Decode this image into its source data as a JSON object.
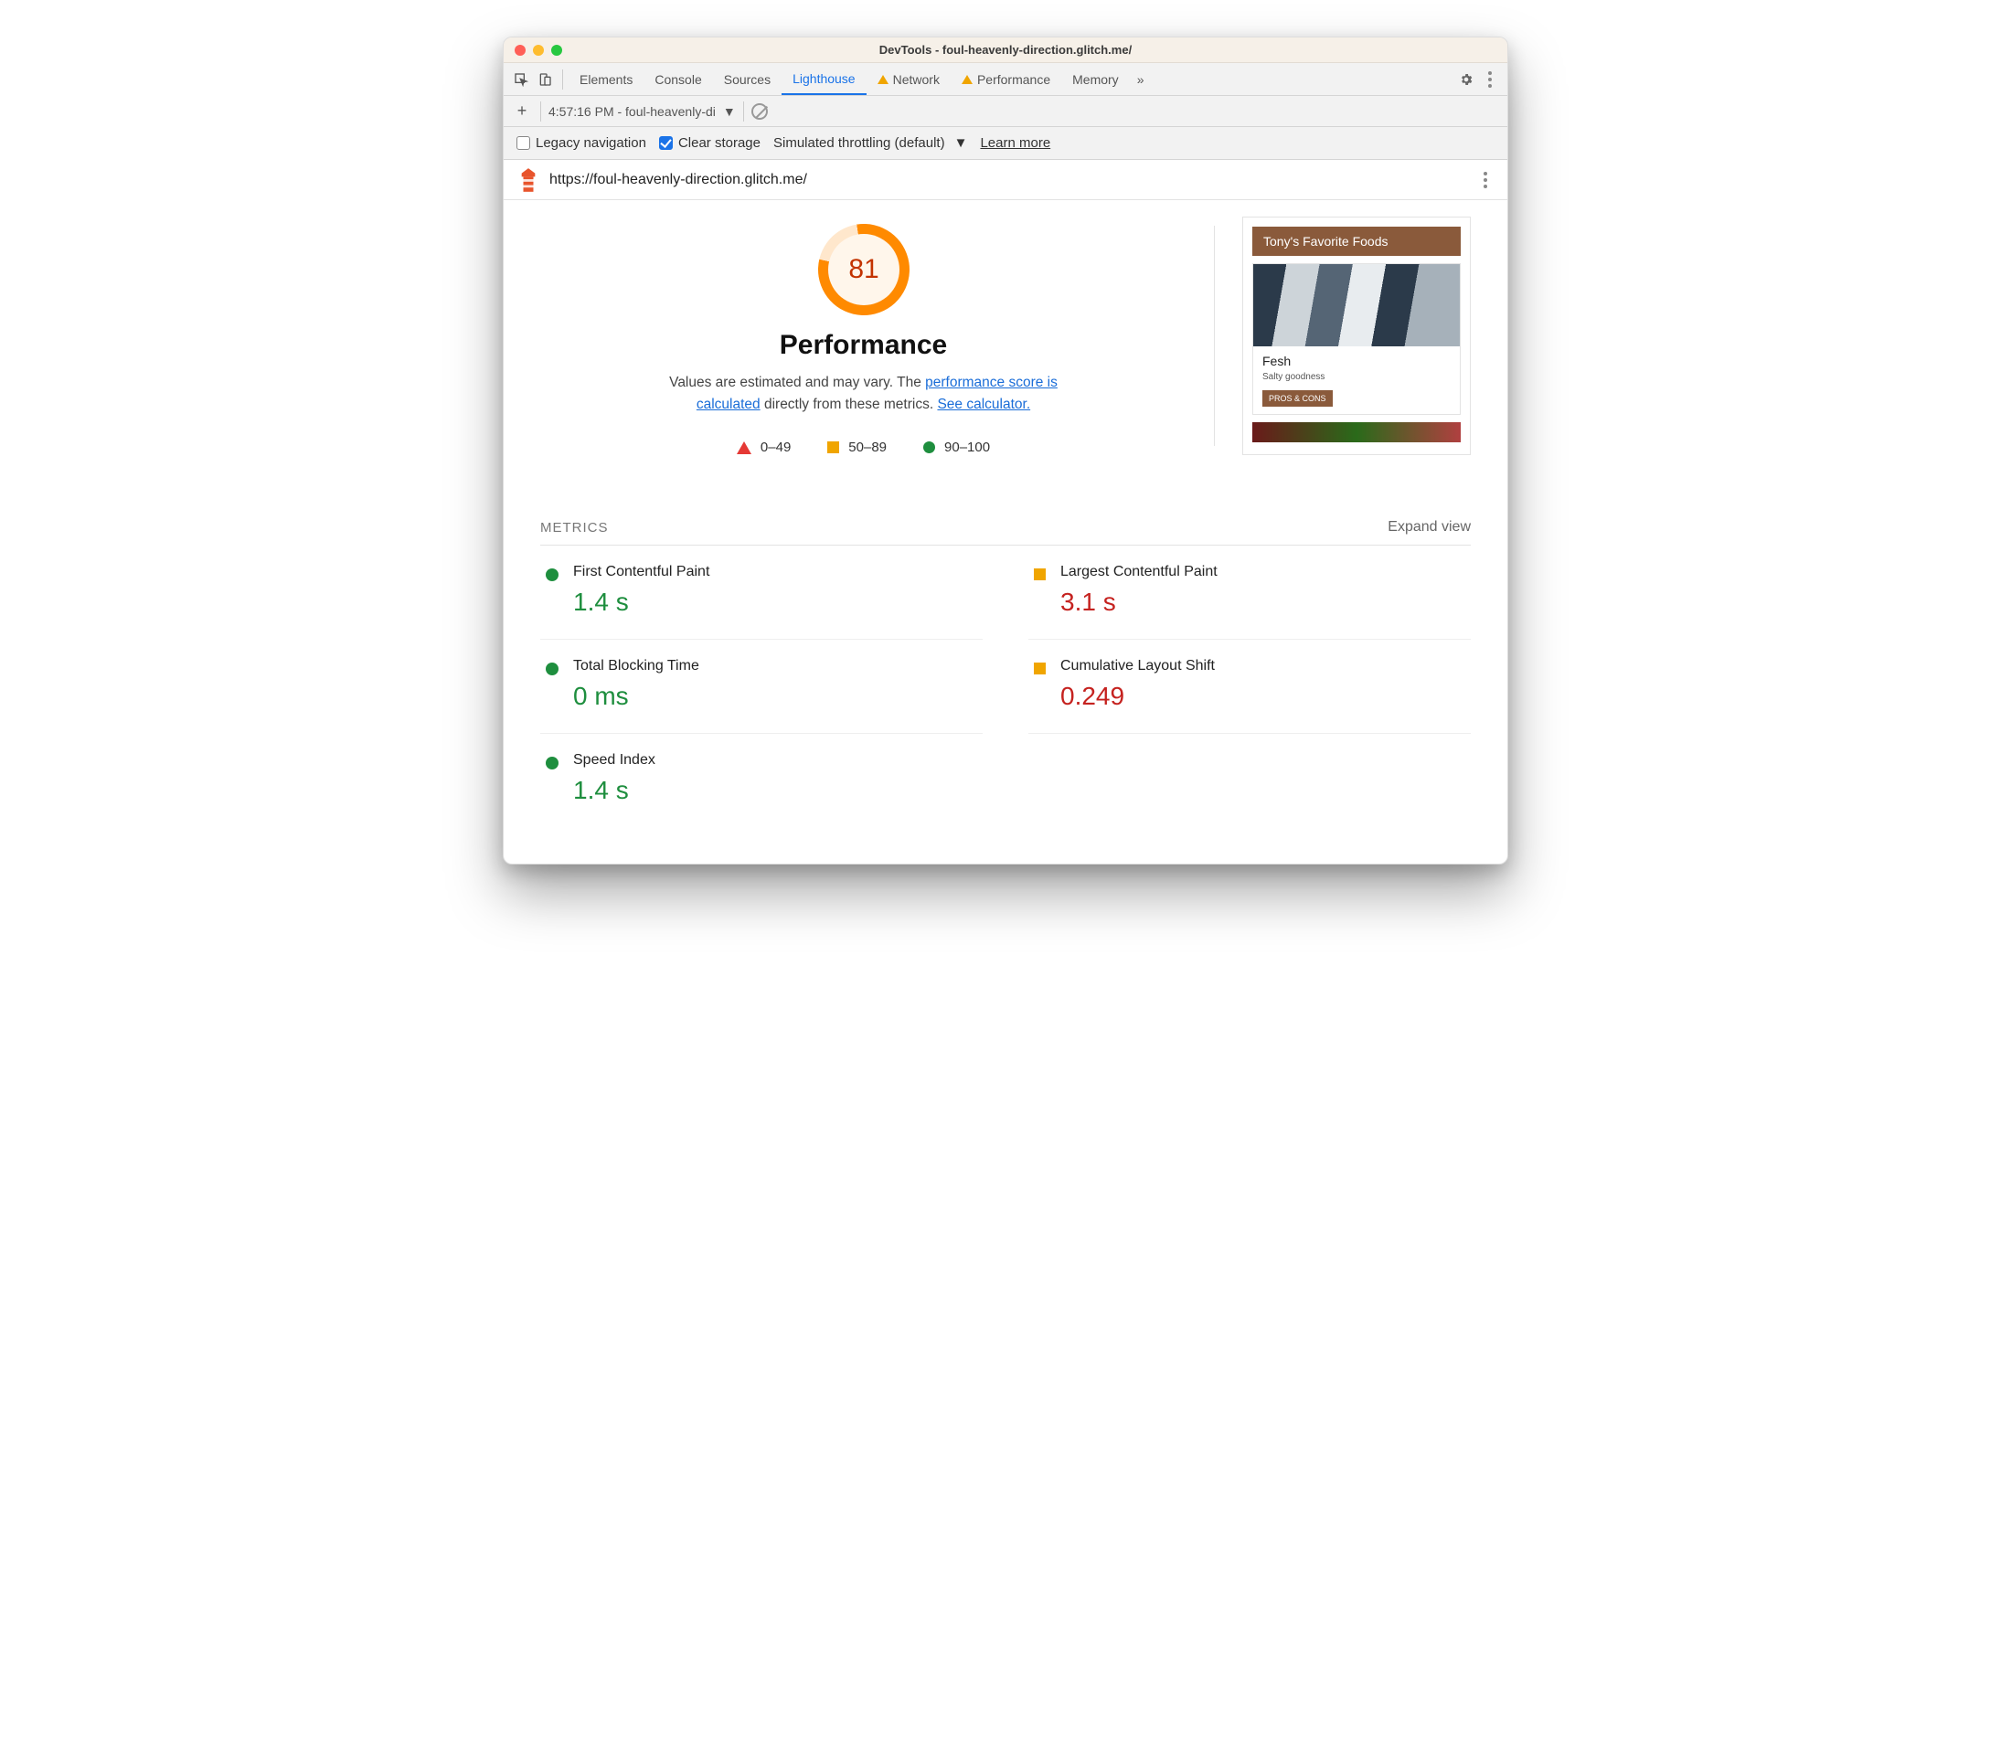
{
  "window": {
    "title": "DevTools - foul-heavenly-direction.glitch.me/"
  },
  "tabs": {
    "elements": "Elements",
    "console": "Console",
    "sources": "Sources",
    "lighthouse": "Lighthouse",
    "network": "Network",
    "performance": "Performance",
    "memory": "Memory"
  },
  "secondbar": {
    "report_label": "4:57:16 PM - foul-heavenly-di"
  },
  "options": {
    "legacy_nav": "Legacy navigation",
    "clear_storage": "Clear storage",
    "throttling": "Simulated throttling (default)",
    "learn_more": "Learn more"
  },
  "urlbar": {
    "url": "https://foul-heavenly-direction.glitch.me/"
  },
  "score": {
    "value": "81",
    "heading": "Performance",
    "desc_pre": "Values are estimated and may vary. The ",
    "link1": "performance score is calculated",
    "desc_mid": " directly from these metrics. ",
    "link2": "See calculator."
  },
  "legend": {
    "bad": "0–49",
    "avg": "50–89",
    "good": "90–100"
  },
  "preview": {
    "title": "Tony's Favorite Foods",
    "card_title": "Fesh",
    "card_sub": "Salty goodness",
    "btn": "PROS & CONS"
  },
  "metrics_section": {
    "label": "METRICS",
    "expand": "Expand view"
  },
  "metrics": {
    "fcp": {
      "name": "First Contentful Paint",
      "value": "1.4 s"
    },
    "lcp": {
      "name": "Largest Contentful Paint",
      "value": "3.1 s"
    },
    "tbt": {
      "name": "Total Blocking Time",
      "value": "0 ms"
    },
    "cls": {
      "name": "Cumulative Layout Shift",
      "value": "0.249"
    },
    "si": {
      "name": "Speed Index",
      "value": "1.4 s"
    }
  },
  "chart_data": {
    "type": "gauge",
    "title": "Performance",
    "value": 81,
    "range": [
      0,
      100
    ],
    "bands": [
      {
        "label": "0–49",
        "color": "#e53935"
      },
      {
        "label": "50–89",
        "color": "#f0a500"
      },
      {
        "label": "90–100",
        "color": "#1e8e3e"
      }
    ],
    "metrics": [
      {
        "name": "First Contentful Paint",
        "value": 1.4,
        "unit": "s",
        "status": "good"
      },
      {
        "name": "Largest Contentful Paint",
        "value": 3.1,
        "unit": "s",
        "status": "average"
      },
      {
        "name": "Total Blocking Time",
        "value": 0,
        "unit": "ms",
        "status": "good"
      },
      {
        "name": "Cumulative Layout Shift",
        "value": 0.249,
        "unit": "",
        "status": "average"
      },
      {
        "name": "Speed Index",
        "value": 1.4,
        "unit": "s",
        "status": "good"
      }
    ]
  }
}
